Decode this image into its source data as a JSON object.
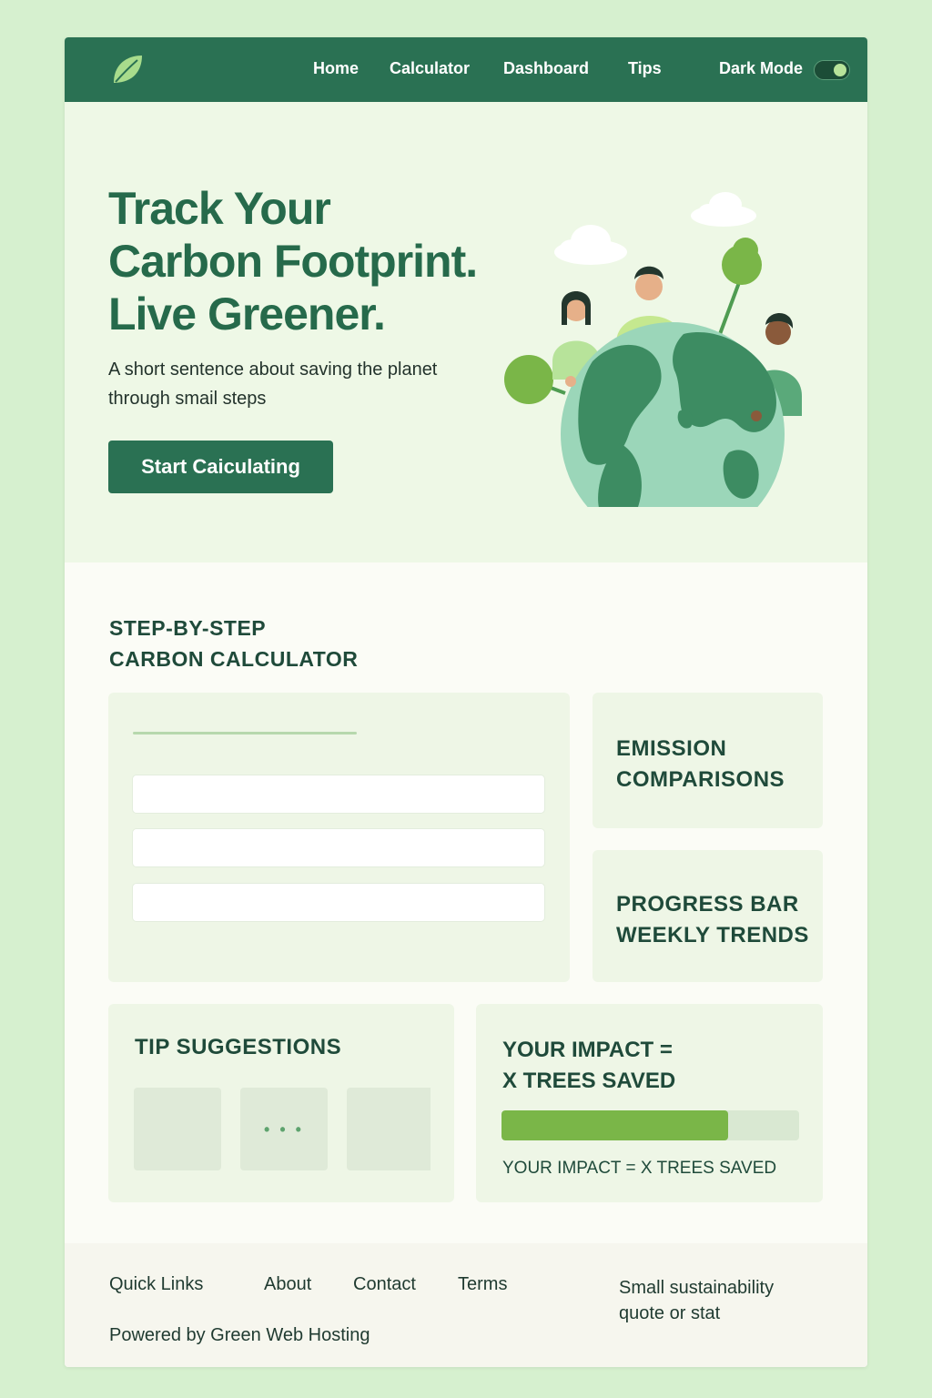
{
  "nav": {
    "links": [
      "Home",
      "Calculator",
      "Dashboard",
      "Tips"
    ],
    "dark_mode_label": "Dark Mode",
    "dark_mode_on": true,
    "logo_icon": "leaf-icon"
  },
  "hero": {
    "title_lines": [
      "Track Your",
      "Carbon Footprint.",
      "Live Greener."
    ],
    "subtitle": "A short sentence about saving the planet through smail steps",
    "cta_label": "Start Caiculating",
    "illustration": "globe-with-people-and-trees"
  },
  "calculator": {
    "title_lines": [
      "STEP-BY-STEP",
      "CARBON CALCULATOR"
    ],
    "input_count_note": "",
    "emission_card_lines": [
      "EMISSION",
      "COMPARISONS"
    ],
    "progress_card_lines": [
      "PROGRESS BAR",
      "WEEKLY TRENDS"
    ]
  },
  "tips": {
    "title": "TIP SUGGESTIONS",
    "middle_box_text": "• • •"
  },
  "impact": {
    "title_lines": [
      "YOUR IMPACT =",
      "X TREES SAVED"
    ],
    "progress_fraction": 0.76,
    "caption": "YOUR IMPACT = X TREES SAVED"
  },
  "footer": {
    "links": [
      "Quick Links",
      "About",
      "Contact",
      "Terms"
    ],
    "quote": "Small sustainability quote or stat",
    "powered_by": "Powered by Green Web Hosting"
  },
  "colors": {
    "primary": "#2a7153",
    "accent": "#7ab648",
    "background": "#d6f0cf",
    "hero_bg": "#eef8e6"
  }
}
